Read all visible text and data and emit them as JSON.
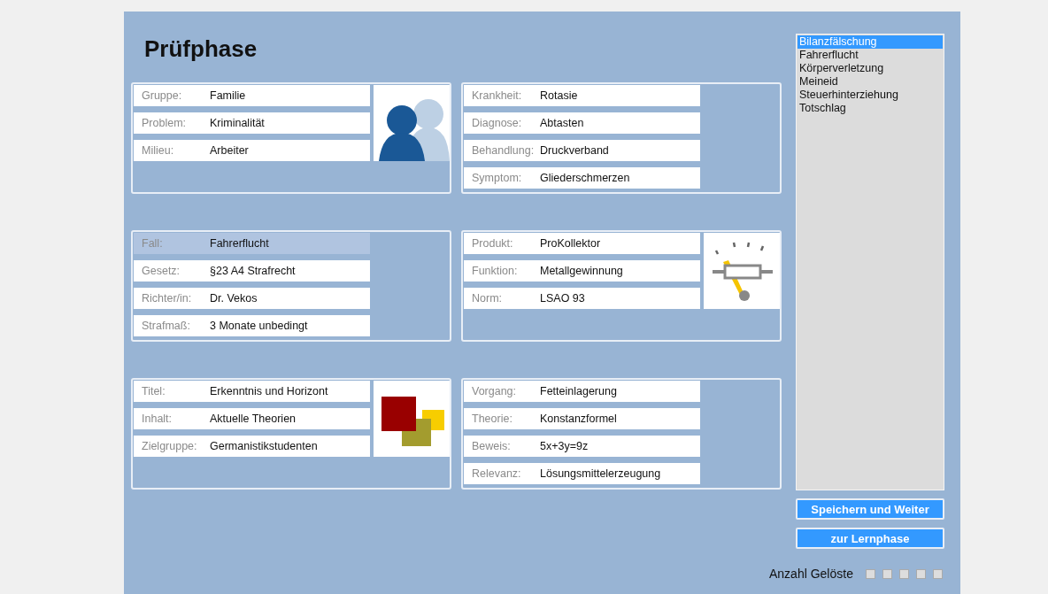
{
  "title": "Prüfphase",
  "cards": [
    {
      "kind": "people",
      "fields": [
        {
          "label": "Gruppe:",
          "value": "Familie",
          "selected": false
        },
        {
          "label": "Problem:",
          "value": "Kriminalität",
          "selected": false
        },
        {
          "label": "Milieu:",
          "value": "Arbeiter",
          "selected": false
        }
      ]
    },
    {
      "kind": "plain",
      "fields": [
        {
          "label": "Krankheit:",
          "value": "Rotasie",
          "selected": false
        },
        {
          "label": "Diagnose:",
          "value": "Abtasten",
          "selected": false
        },
        {
          "label": "Behandlung:",
          "value": "Druckverband",
          "selected": false
        },
        {
          "label": "Symptom:",
          "value": "Gliederschmerzen",
          "selected": false
        }
      ]
    },
    {
      "kind": "plain",
      "fields": [
        {
          "label": "Fall:",
          "value": "Fahrerflucht",
          "selected": true
        },
        {
          "label": "Gesetz:",
          "value": "§23 A4 Strafrecht",
          "selected": false
        },
        {
          "label": "Richter/in:",
          "value": "Dr. Vekos",
          "selected": false
        },
        {
          "label": "Strafmaß:",
          "value": "3 Monate unbedingt",
          "selected": false
        }
      ]
    },
    {
      "kind": "gauge",
      "fields": [
        {
          "label": "Produkt:",
          "value": "ProKollektor",
          "selected": false
        },
        {
          "label": "Funktion:",
          "value": "Metallgewinnung",
          "selected": false
        },
        {
          "label": "Norm:",
          "value": "LSAO 93",
          "selected": false
        }
      ]
    },
    {
      "kind": "squares",
      "fields": [
        {
          "label": "Titel:",
          "value": "Erkenntnis und Horizont",
          "selected": false
        },
        {
          "label": "Inhalt:",
          "value": "Aktuelle Theorien",
          "selected": false
        },
        {
          "label": "Zielgruppe:",
          "value": "Germanistikstudenten",
          "selected": false
        }
      ]
    },
    {
      "kind": "plain",
      "fields": [
        {
          "label": "Vorgang:",
          "value": "Fetteinlagerung",
          "selected": false
        },
        {
          "label": "Theorie:",
          "value": "Konstanzformel",
          "selected": false
        },
        {
          "label": "Beweis:",
          "value": "5x+3y=9z",
          "selected": false
        },
        {
          "label": "Relevanz:",
          "value": "Lösungsmittelerzeugung",
          "selected": false
        }
      ]
    }
  ],
  "list": [
    {
      "label": "Bilanzfälschung",
      "selected": true
    },
    {
      "label": "Fahrerflucht",
      "selected": false
    },
    {
      "label": "Körperverletzung",
      "selected": false
    },
    {
      "label": "Meineid",
      "selected": false
    },
    {
      "label": "Steuerhinterziehung",
      "selected": false
    },
    {
      "label": "Totschlag",
      "selected": false
    }
  ],
  "buttons": [
    "Speichern und Weiter",
    "zur Lernphase"
  ],
  "solved": {
    "label": "Anzahl Gelöste",
    "boxes": [
      {
        "checked": false
      },
      {
        "checked": false
      },
      {
        "checked": false
      },
      {
        "checked": false
      },
      {
        "checked": false
      }
    ]
  }
}
